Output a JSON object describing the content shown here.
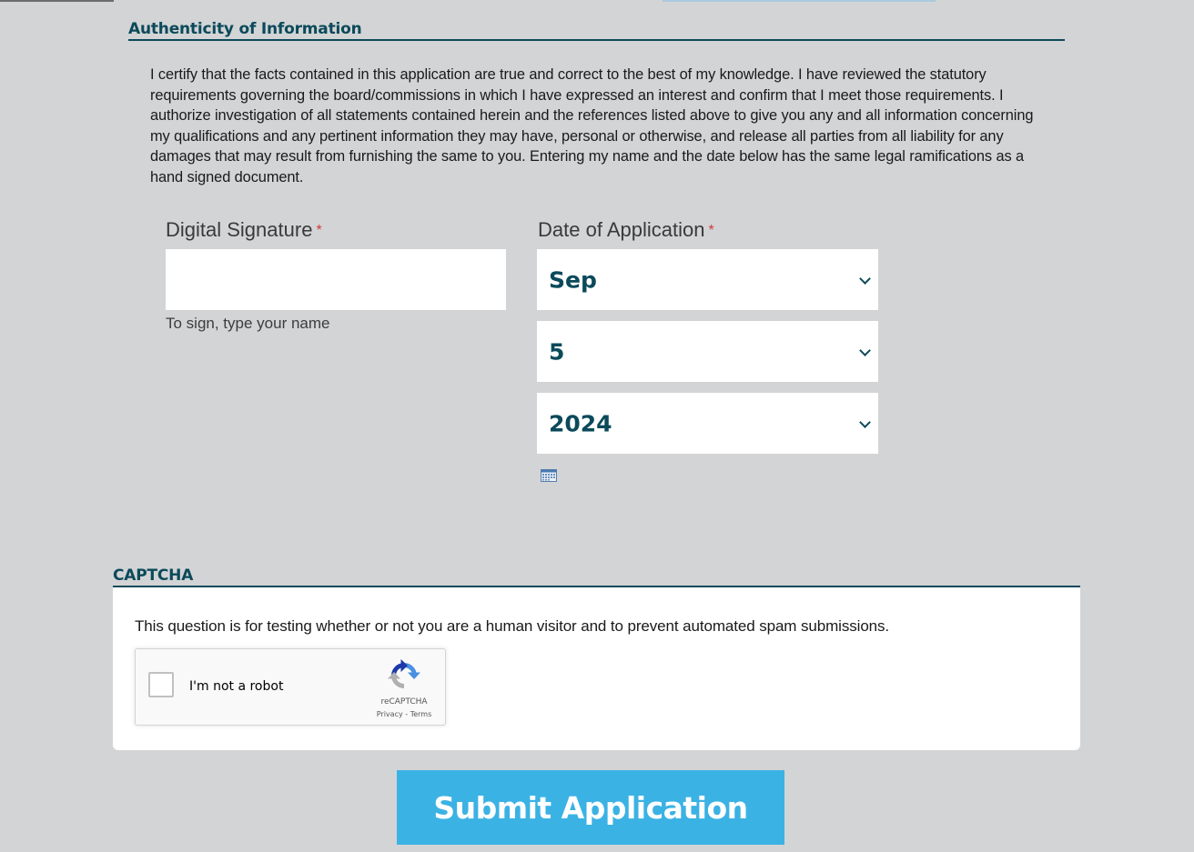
{
  "authenticity": {
    "heading": "Authenticity of Information",
    "paragraph": "I certify that the facts contained in this application are true and correct to the best of my knowledge. I have reviewed the statutory requirements governing the board/commissions in which I have expressed an interest and confirm that I meet those requirements. I authorize investigation of all statements contained herein and the references listed above to give you any and all information concerning my qualifications and any pertinent information they may have, personal or otherwise, and release all parties from all liability for any damages that may result from furnishing the same to you. Entering my name and the date below has the same legal ramifications as a hand signed document."
  },
  "signature": {
    "label": "Digital Signature",
    "required_mark": "*",
    "value": "",
    "hint": "To sign, type your name"
  },
  "date_of_application": {
    "label": "Date of Application",
    "required_mark": "*",
    "month": "Sep",
    "day": "5",
    "year": "2024",
    "calendar_icon": "calendar-icon"
  },
  "captcha": {
    "heading": "CAPTCHA",
    "description": "This question is for testing whether or not you are a human visitor and to prevent automated spam submissions.",
    "checkbox_label": "I'm not a robot",
    "brand": "reCAPTCHA",
    "privacy_link": "Privacy",
    "separator": " - ",
    "terms_link": "Terms"
  },
  "submit": {
    "label": "Submit Application"
  },
  "colors": {
    "background": "#d3d4d6",
    "heading": "#0b4a5a",
    "required": "#d13a3a",
    "submit": "#3bb2e4"
  }
}
